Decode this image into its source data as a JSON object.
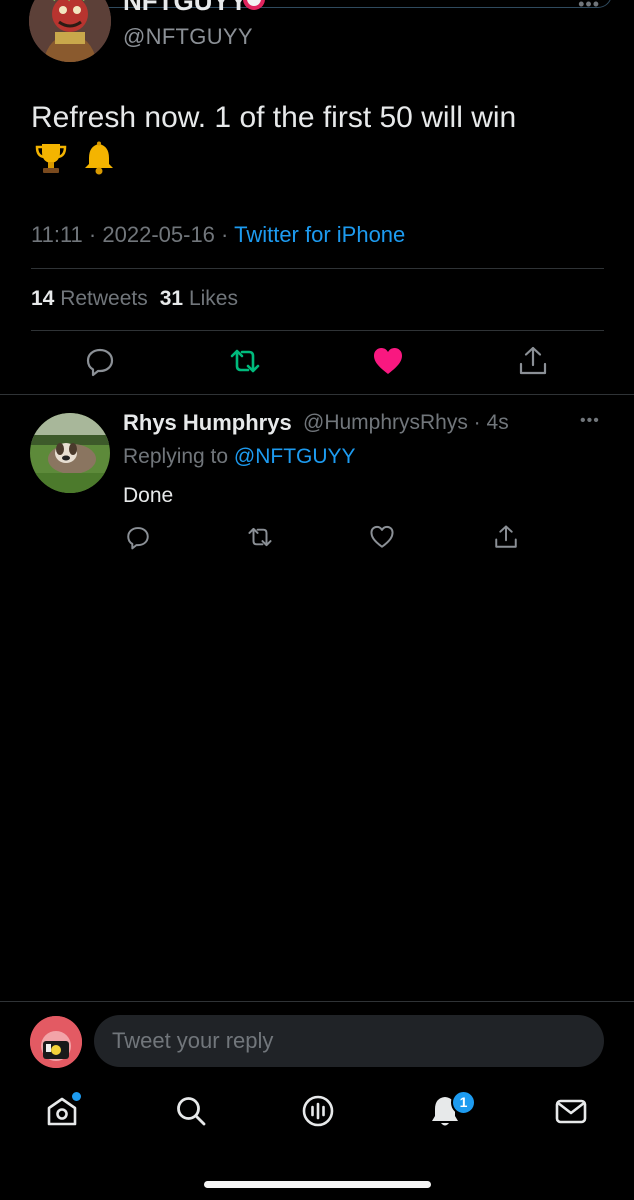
{
  "author": {
    "name": "NFTGUYY",
    "handle": "@NFTGUYY"
  },
  "tweet": {
    "text": "Refresh now. 1 of the first 50 will win",
    "emojis": [
      "trophy-icon",
      "bell-icon"
    ],
    "time": "11:11",
    "date": "2022-05-16",
    "source": "Twitter for iPhone",
    "retweets": "14",
    "retweets_label": "Retweets",
    "likes": "31",
    "likes_label": "Likes"
  },
  "reply": {
    "name": "Rhys Humphrys",
    "handle_time": "@HumphrysRhys · 4s",
    "replying_prefix": "Replying to",
    "replying_to": "@NFTGUYY",
    "text": "Done"
  },
  "composer": {
    "placeholder": "Tweet your reply"
  },
  "tabbar": {
    "notifications_count": "1"
  },
  "colors": {
    "accent": "#1d9bf0",
    "retweet": "#00ba7c",
    "like": "#f91880",
    "muted": "#71767b",
    "background": "#000000"
  }
}
